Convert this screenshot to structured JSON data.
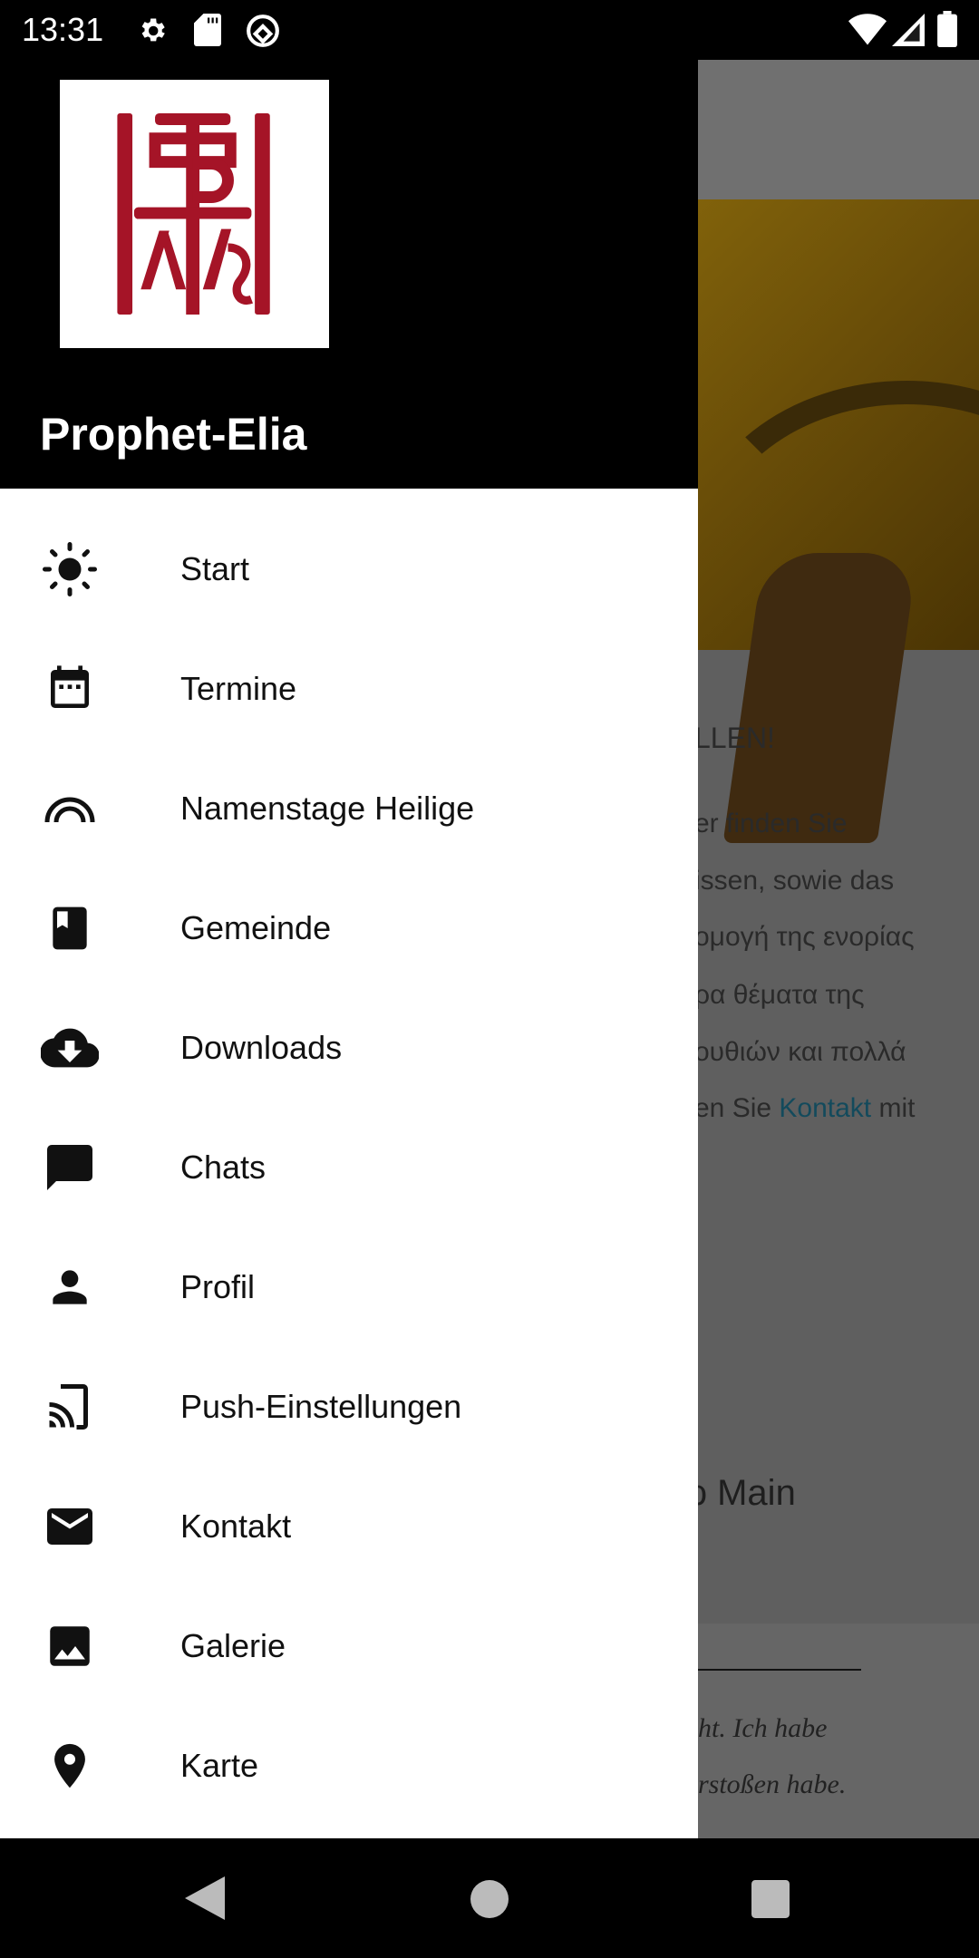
{
  "status_bar": {
    "time": "13:31",
    "icons": [
      "gear-icon",
      "sd-card-icon",
      "vpn-icon",
      "wifi-icon",
      "signal-icon",
      "battery-icon"
    ]
  },
  "drawer": {
    "title": "Prophet-Elia",
    "logo_text": "ΠΡ ΗΛΙΑΣ",
    "items": [
      {
        "label": "Start",
        "icon": "sun-icon"
      },
      {
        "label": "Termine",
        "icon": "calendar-icon"
      },
      {
        "label": "Namenstage Heilige",
        "icon": "rainbow-icon"
      },
      {
        "label": "Gemeinde",
        "icon": "book-icon"
      },
      {
        "label": "Downloads",
        "icon": "cloud-download-icon"
      },
      {
        "label": "Chats",
        "icon": "chat-icon"
      },
      {
        "label": "Profil",
        "icon": "person-icon"
      },
      {
        "label": "Push-Einstellungen",
        "icon": "cast-icon"
      },
      {
        "label": "Kontakt",
        "icon": "mail-icon"
      },
      {
        "label": "Galerie",
        "icon": "image-icon"
      },
      {
        "label": "Karte",
        "icon": "location-pin-icon"
      }
    ]
  },
  "background": {
    "heading1": "LLEN!",
    "lines": [
      "er finden Sie",
      "issen, sowie das",
      "ομογή της ενορίας",
      "ρα θέματα της",
      "ουθιών και πολλά"
    ],
    "line6_before": "en Sie ",
    "line6_link": "Kontakt",
    "line6_after": " mit",
    "heading2": "ɔ Main",
    "quote": [
      "ht. Ich habe",
      "rstoßen habe."
    ]
  },
  "colors": {
    "logo_red": "#a51427",
    "link": "#134a5c"
  }
}
